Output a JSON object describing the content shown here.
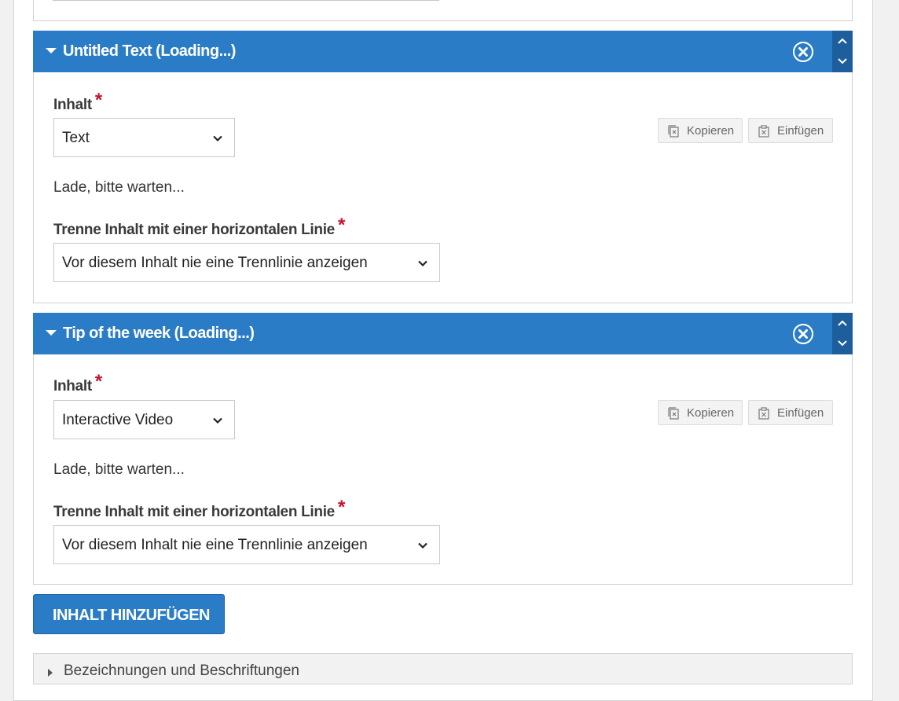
{
  "items": [
    {
      "title": "Untitled Text (Loading...)",
      "content_label": "Inhalt",
      "required_mark": "*",
      "content_value": "Text",
      "loading_text": "Lade, bitte warten...",
      "separator_label": "Trenne Inhalt mit einer horizontalen Linie",
      "separator_value": "Vor diesem Inhalt nie eine Trennlinie anzeigen",
      "copy_label": "Kopieren",
      "paste_label": "Einfügen"
    },
    {
      "title": "Tip of the week (Loading...)",
      "content_label": "Inhalt",
      "required_mark": "*",
      "content_value": "Interactive Video",
      "loading_text": "Lade, bitte warten...",
      "separator_label": "Trenne Inhalt mit einer horizontalen Linie",
      "separator_value": "Vor diesem Inhalt nie eine Trennlinie anzeigen",
      "copy_label": "Kopieren",
      "paste_label": "Einfügen"
    }
  ],
  "add_button_label": "INHALT HINZUFÜGEN",
  "next_group_title": "Bezeichnungen und Beschriftungen",
  "colors": {
    "header_blue": "#2a7cc7",
    "order_blue": "#1e5e9c",
    "required_red": "#c8102e"
  },
  "icons": {
    "collapse": "caret-down-icon",
    "remove": "close-circle-icon",
    "move_up": "chevron-up-icon",
    "move_down": "chevron-down-icon",
    "copy": "copy-icon",
    "paste": "paste-icon",
    "group": "caret-right-icon"
  }
}
